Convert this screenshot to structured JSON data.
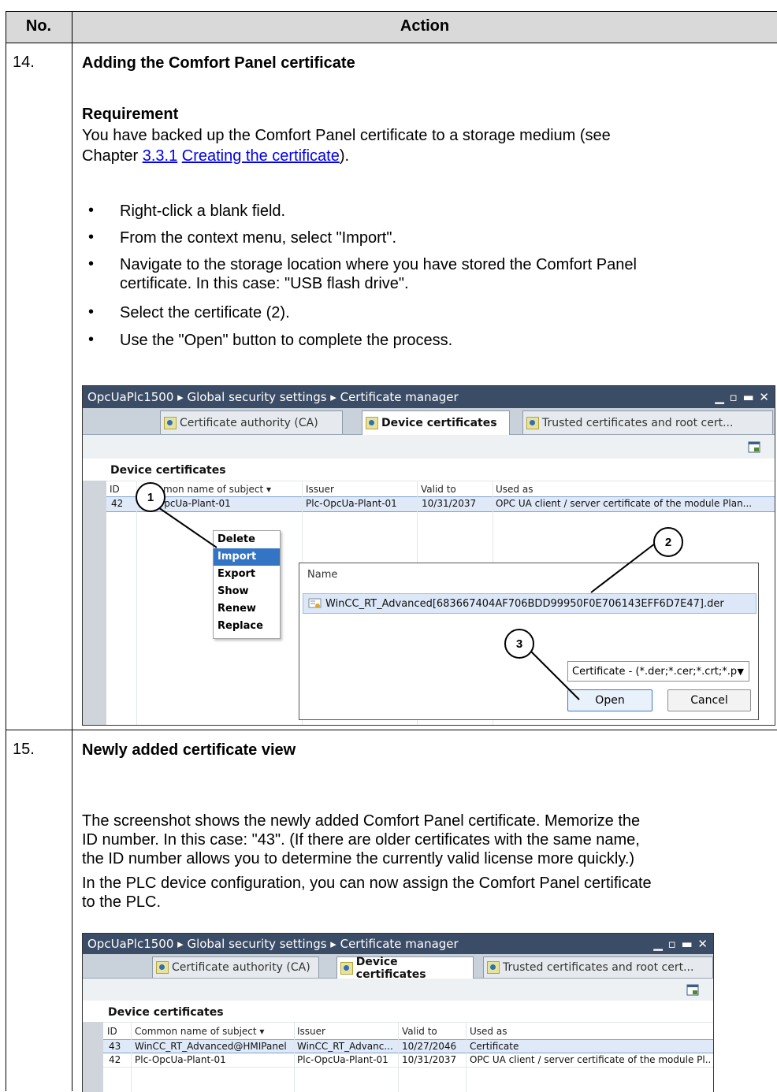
{
  "table": {
    "col_no": "No.",
    "col_action": "Action"
  },
  "step14": {
    "number": "14.",
    "title": "Adding the Comfort Panel certificate",
    "req_title": "Requirement",
    "req_text_1": "You have backed up the Comfort Panel certificate to a storage medium (see",
    "req_text_2a": "Chapter ",
    "req_link_num": "3.3.1",
    "req_link_text": "Creating the certificate",
    "req_text_2b": ").",
    "bullets": [
      "Right-click a blank field.",
      "From the context menu, select \"Import\".",
      "Navigate to the storage location where you have stored the Comfort Panel",
      "certificate. In this case: \"USB flash drive\".",
      "Select the certificate (2).",
      "Use the \"Open\" button to complete the process."
    ]
  },
  "shot1": {
    "breadcrumb": "OpcUaPlc1500  ▸  Global security settings  ▸  Certificate manager",
    "controls": "▁ ▫ ▬ ✕",
    "tabs": [
      "Certificate authority (CA)",
      "Device certificates",
      "Trusted certificates and root cert..."
    ],
    "section": "Device certificates",
    "headers": {
      "id": "ID",
      "name": "mon name of subject  ▾",
      "issuer": "Issuer",
      "valid": "Valid to",
      "used": "Used as"
    },
    "row": {
      "id": "42",
      "name": "Plc-OpcUa-Plant-01",
      "issuer": "Plc-OpcUa-Plant-01",
      "valid": "10/31/2037",
      "used": "OPC UA client / server certificate of the module Plan..."
    },
    "menu": [
      "Delete",
      "Import",
      "Export",
      "Show",
      "Renew",
      "Replace"
    ],
    "dialog": {
      "col_name": "Name",
      "file": "WinCC_RT_Advanced[683667404AF706BDD99950F0E706143EFF6D7E47].der",
      "filter": "Certificate -  (*.der;*.cer;*.crt;*.p",
      "open": "Open",
      "cancel": "Cancel"
    },
    "callouts": [
      "1",
      "2",
      "3"
    ]
  },
  "step15": {
    "number": "15.",
    "title": "Newly added certificate view",
    "p1": [
      "The screenshot shows the newly added Comfort Panel certificate. Memorize the",
      "ID number. In this case: \"43\". (If there are older certificates with the same name,",
      "the ID number allows you to determine the currently valid license more quickly.)"
    ],
    "p2": [
      "In the PLC device configuration, you can now assign the Comfort Panel certificate",
      "to the PLC."
    ]
  },
  "shot2": {
    "breadcrumb": "OpcUaPlc1500  ▸  Global security settings  ▸  Certificate manager",
    "controls": "▁ ▫ ▬ ✕",
    "tabs": [
      "Certificate authority (CA)",
      "Device certificates",
      "Trusted certificates and root cert..."
    ],
    "section": "Device certificates",
    "headers": {
      "id": "ID",
      "name": "Common name of subject  ▾",
      "issuer": "Issuer",
      "valid": "Valid to",
      "used": "Used as"
    },
    "rows": [
      {
        "id": "43",
        "name": "WinCC_RT_Advanced@HMIPanel",
        "issuer": "WinCC_RT_Advanc...",
        "valid": "10/27/2046",
        "used": "Certificate"
      },
      {
        "id": "42",
        "name": "Plc-OpcUa-Plant-01",
        "issuer": "Plc-OpcUa-Plant-01",
        "valid": "10/31/2037",
        "used": "OPC UA client / server certificate of the module Pl..."
      }
    ]
  }
}
